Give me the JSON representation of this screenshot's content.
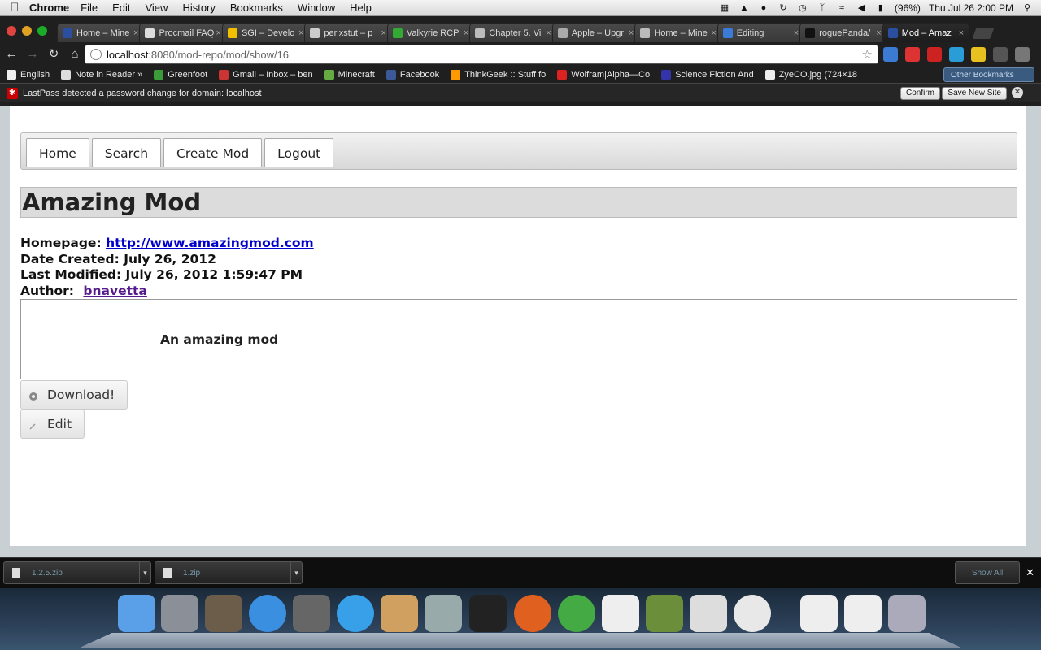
{
  "menubar": {
    "app_name": "Chrome",
    "items": [
      "File",
      "Edit",
      "View",
      "History",
      "Bookmarks",
      "Window",
      "Help"
    ],
    "battery": "(96%)",
    "clock": "Thu Jul 26  2:00 PM"
  },
  "browser": {
    "tabs": [
      {
        "label": "Home – Mine",
        "active": false
      },
      {
        "label": "Procmail FAQ",
        "active": false
      },
      {
        "label": "SGI – Develo",
        "active": false
      },
      {
        "label": "perlxstut – p",
        "active": false
      },
      {
        "label": "Valkyrie RCP",
        "active": false
      },
      {
        "label": "Chapter 5. Vi",
        "active": false
      },
      {
        "label": "Apple – Upgr",
        "active": false
      },
      {
        "label": "Home – Mine",
        "active": false
      },
      {
        "label": "Editing",
        "active": false
      },
      {
        "label": "roguePanda/",
        "active": false
      },
      {
        "label": "Mod – Amaz",
        "active": true
      }
    ],
    "url_host": "localhost",
    "url_path": ":8080/mod-repo/mod/show/16",
    "bookmarks": [
      "English",
      "Note in Reader »",
      "Greenfoot",
      "Gmail – Inbox – ben",
      "Minecraft",
      "Facebook",
      "ThinkGeek :: Stuff fo",
      "Wolfram|Alpha—Co",
      "Science Fiction And",
      "ZyeCO.jpg (724×18"
    ],
    "other_bookmarks": "Other Bookmarks",
    "infobar": {
      "message": "LastPass detected a password change for domain: localhost",
      "confirm": "Confirm",
      "save_new_site": "Save New Site"
    }
  },
  "page": {
    "nav": [
      "Home",
      "Search",
      "Create Mod",
      "Logout"
    ],
    "title": "Amazing Mod",
    "homepage_label": "Homepage:",
    "homepage_url": "http://www.amazingmod.com",
    "date_created": "Date Created: July 26, 2012",
    "last_modified": "Last Modified: July 26, 2012 1:59:47 PM",
    "author_label": "Author:",
    "author": "bnavetta",
    "description": "An amazing mod",
    "download_label": "Download!",
    "edit_label": "Edit"
  },
  "downloads": {
    "items": [
      "1.2.5.zip",
      "1.zip"
    ],
    "show_all": "Show All"
  },
  "dock": {
    "icons": [
      "finder-icon",
      "launchpad-icon",
      "photo-booth-icon",
      "app-store-icon",
      "facetime-icon",
      "itunes-icon",
      "iphoto-icon",
      "system-preferences-icon",
      "terminal-icon",
      "firefox-icon",
      "eclipse-icon",
      "textedit-icon",
      "minecraft-icon",
      "blank-app-icon",
      "chrome-icon",
      "documents-stack-icon",
      "downloads-stack-icon",
      "trash-icon"
    ]
  }
}
